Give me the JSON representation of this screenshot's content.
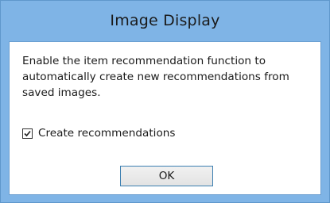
{
  "dialog": {
    "title": "Image Display",
    "message": "Enable the item recommendation function to automatically create new recommendations from saved images.",
    "checkbox": {
      "label": "Create recommendations",
      "checked": true
    },
    "ok_label": "OK"
  },
  "colors": {
    "frame": "#7fb4e6",
    "client_bg": "#ffffff",
    "button_border_focus": "#3c7fb1"
  }
}
